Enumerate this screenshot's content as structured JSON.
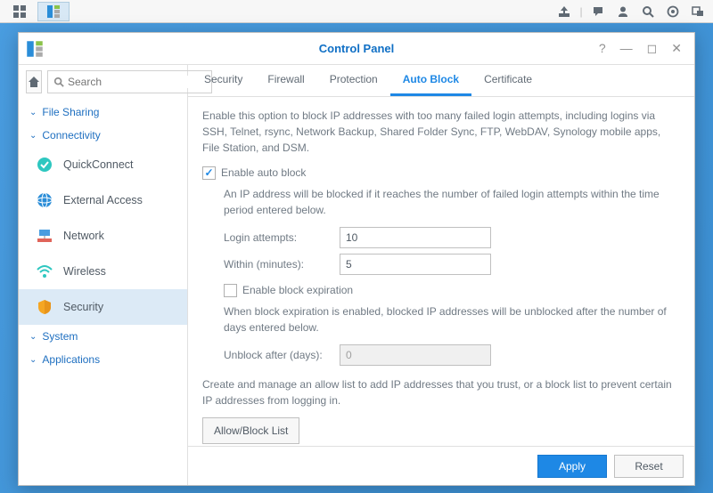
{
  "taskbar": {
    "apps": [
      "grid",
      "control-panel"
    ]
  },
  "window": {
    "title": "Control Panel"
  },
  "search": {
    "placeholder": "Search"
  },
  "sidebar": {
    "sections": {
      "file_sharing": "File Sharing",
      "connectivity": "Connectivity",
      "system": "System",
      "applications": "Applications"
    },
    "items": {
      "quickconnect": "QuickConnect",
      "external_access": "External Access",
      "network": "Network",
      "wireless": "Wireless",
      "security": "Security"
    }
  },
  "tabs": {
    "security": "Security",
    "firewall": "Firewall",
    "protection": "Protection",
    "auto_block": "Auto Block",
    "certificate": "Certificate"
  },
  "text": {
    "intro": "Enable this option to block IP addresses with too many failed login attempts, including logins via SSH, Telnet, rsync, Network Backup, Shared Folder Sync, FTP, WebDAV, Synology mobile apps, File Station, and DSM.",
    "enable_auto_block": "Enable auto block",
    "desc_lockout": "An IP address will be blocked if it reaches the number of failed login attempts within the time period entered below.",
    "login_attempts_label": "Login attempts:",
    "within_label": "Within (minutes):",
    "enable_expiration": "Enable block expiration",
    "desc_expiration": "When block expiration is enabled, blocked IP addresses will be unblocked after the number of days entered below.",
    "unblock_after_label": "Unblock after (days):",
    "allowlist_desc": "Create and manage an allow list to add IP addresses that you trust, or a block list to prevent certain IP addresses from logging in.",
    "allow_block_btn": "Allow/Block List",
    "apply": "Apply",
    "reset": "Reset"
  },
  "values": {
    "login_attempts": "10",
    "within_minutes": "5",
    "unblock_after_days": "0",
    "auto_block_checked": true,
    "expiration_checked": false
  }
}
